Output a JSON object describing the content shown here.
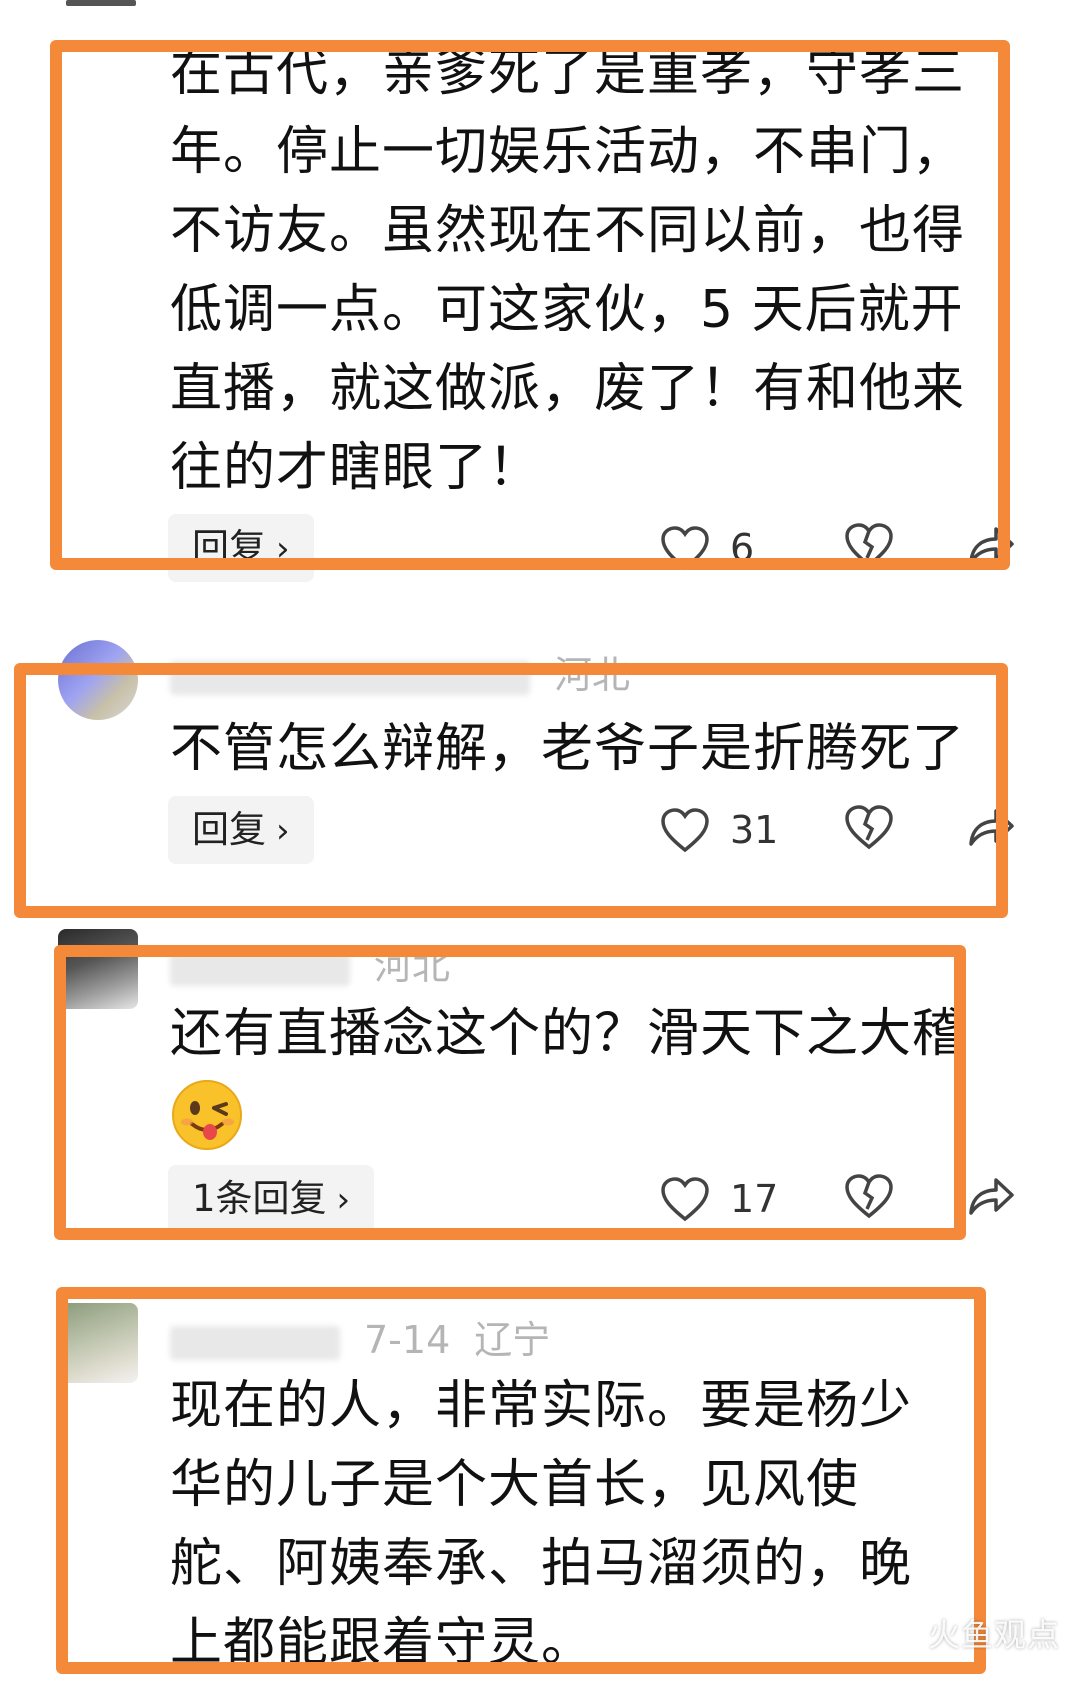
{
  "comments": [
    {
      "meta_region": "",
      "text": "在古代，亲爹死了是重孝，守孝三年。停止一切娱乐活动，不串门，不访友。虽然现在不同以前，也得低调一点。可这家伙，5 天后就开直播，就这做派，废了！有和他来往的才瞎眼了！",
      "reply_label": "回复",
      "likes": "6"
    },
    {
      "meta_region": "河北",
      "text": "不管怎么辩解，老爷子是折腾死了",
      "reply_label": "回复",
      "likes": "31"
    },
    {
      "meta_region": "河北",
      "text": "还有直播念这个的？滑天下之大稽",
      "reply_label": "1条回复",
      "likes": "17"
    },
    {
      "meta_date": "7-14",
      "meta_region": "辽宁",
      "text": "现在的人，非常实际。要是杨少华的儿子是个大首长，见风使舵、阿姨奉承、拍马溜须的，晚上都能跟着守灵。"
    }
  ],
  "watermark": "火鱼观点",
  "colors": {
    "highlight": "#f5893a",
    "text": "#111111",
    "meta": "#b5b5b5",
    "reply_bg": "#f3f3f3"
  },
  "icons": [
    "heart-icon",
    "broken-heart-icon",
    "share-arrow-icon",
    "chevron-right-icon",
    "winking-tongue-emoji"
  ]
}
